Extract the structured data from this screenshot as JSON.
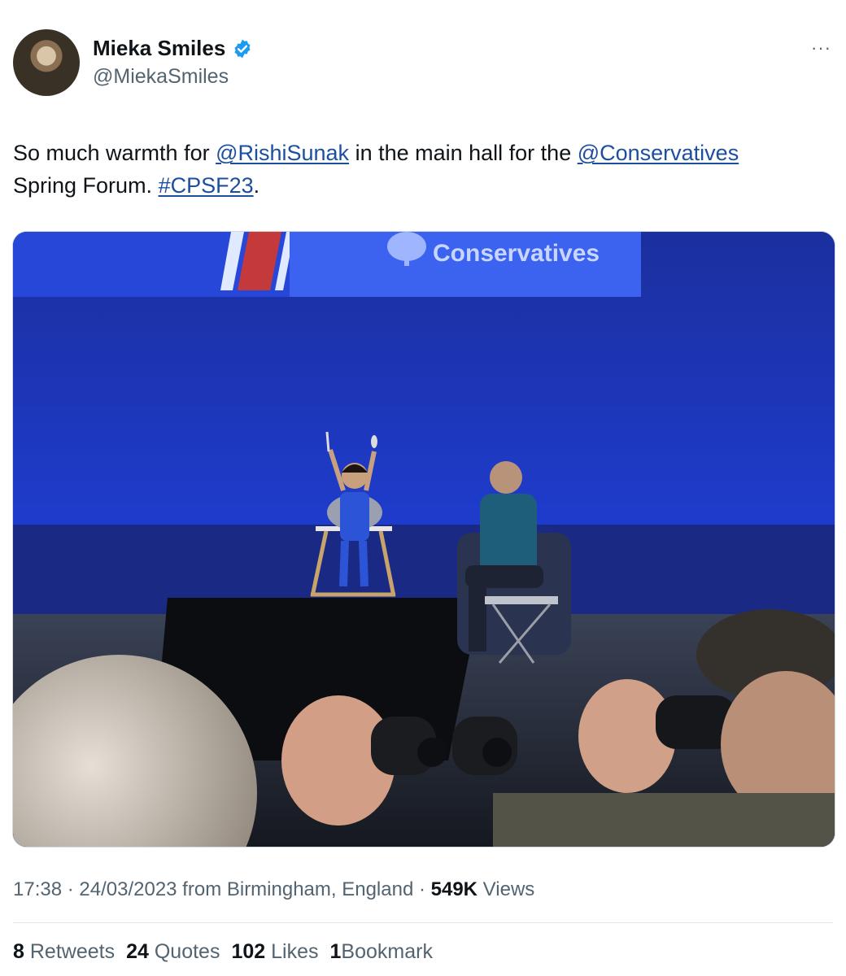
{
  "author": {
    "display_name": "Mieka Smiles",
    "handle": "@MiekaSmiles",
    "verified_icon": "verified-badge-icon"
  },
  "more_menu": "···",
  "tweet": {
    "text_1": "So much warmth for ",
    "mention_1": "@RishiSunak",
    "text_2": " in the main hall for the ",
    "mention_2": "@Conservatives",
    "text_3": " Spring Forum. ",
    "hashtag": "#CPSF23",
    "text_4": "."
  },
  "media": {
    "banner_text": "Conservatives"
  },
  "meta": {
    "time": "17:38",
    "sep1": " · ",
    "date": "24/03/2023",
    "location": " from Birmingham, England",
    "sep2": " · ",
    "views_count": "549K",
    "views_label": " Views"
  },
  "stats": {
    "retweets_count": "8",
    "retweets_label": "Retweets",
    "quotes_count": "24",
    "quotes_label": "Quotes",
    "likes_count": "102",
    "likes_label": "Likes",
    "bookmarks_count": "1",
    "bookmarks_label": "Bookmark"
  },
  "colors": {
    "link": "#1d4fa0",
    "verified": "#1d9bf0",
    "muted": "#536471",
    "stage_blue": "#1a35c8"
  }
}
